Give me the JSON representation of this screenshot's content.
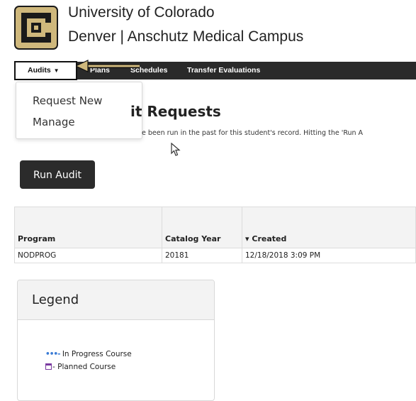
{
  "header": {
    "line1": "University of Colorado",
    "line2": "Denver | Anschutz Medical Campus"
  },
  "nav": {
    "audits_label": "Audits",
    "plans_label": "Plans",
    "schedules_label": "Schedules",
    "transfer_label": "Transfer Evaluations"
  },
  "dropdown": {
    "items": [
      "Request New",
      "Manage"
    ]
  },
  "page": {
    "title_fragment": "it Requests",
    "description_fragment": "e been run in the past for this student's record. Hitting the 'Run A",
    "run_audit_label": "Run Audit"
  },
  "table": {
    "headers": [
      "Program",
      "Catalog Year",
      "Created"
    ],
    "sort_indicator": "▾",
    "rows": [
      [
        "NODPROG",
        "20181",
        "12/18/2018 3:09 PM"
      ]
    ]
  },
  "legend": {
    "title": "Legend",
    "in_progress_marker": "•••-",
    "in_progress_label": " In Progress Course",
    "planned_label": "- Planned Course"
  },
  "colors": {
    "navbar": "#2a2a2a",
    "logo_gold": "#CFB87C",
    "button": "#2b2b2b",
    "in_progress": "#3a7bd5",
    "planned": "#7a3aa0"
  }
}
